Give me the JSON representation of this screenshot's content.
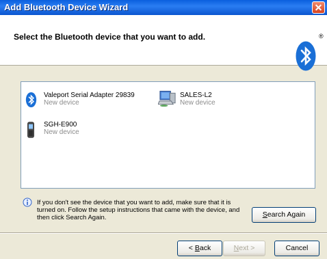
{
  "window": {
    "title": "Add Bluetooth Device Wizard",
    "close_icon": "close-icon"
  },
  "header": {
    "title": "Select the Bluetooth device that you want to add.",
    "logo_icon": "bluetooth-logo-icon",
    "logo_mark": "®"
  },
  "devices": [
    {
      "name": "Valeport Serial Adapter 29839",
      "status": "New device",
      "icon": "bluetooth-icon"
    },
    {
      "name": "SALES-L2",
      "status": "New device",
      "icon": "computer-icon"
    },
    {
      "name": "SGH-E900",
      "status": "New device",
      "icon": "mobile-phone-icon"
    }
  ],
  "info": {
    "icon": "info-icon",
    "text": "If you don't see the device that you want to add, make sure that it is turned on. Follow the setup instructions that came with the device, and then click Search Again."
  },
  "buttons": {
    "search_again": {
      "accel": "S",
      "rest": "earch Again"
    },
    "back": {
      "prefix": "< ",
      "accel": "B",
      "rest": "ack"
    },
    "next": {
      "accel": "N",
      "rest": "ext >"
    },
    "cancel": "Cancel"
  },
  "colors": {
    "titlebar": "#0a5fde",
    "dialog_bg": "#ece9d8",
    "bluetooth_blue": "#1a6fd6",
    "status_gray": "#8c8c8c"
  }
}
